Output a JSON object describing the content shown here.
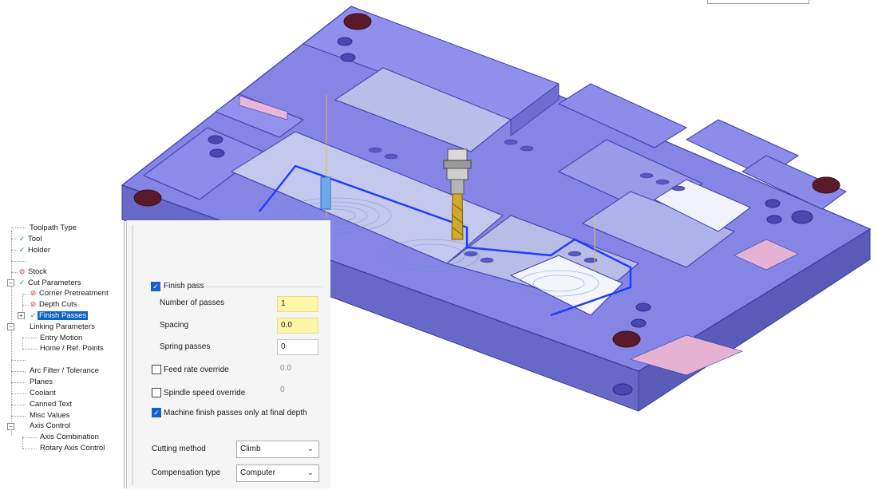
{
  "tree": {
    "items": [
      {
        "label": "Toolpath Type",
        "status": "none"
      },
      {
        "label": "Tool",
        "status": "ok"
      },
      {
        "label": "Holder",
        "status": "ok"
      },
      {
        "label": "Stock",
        "status": "bad"
      },
      {
        "label": "Cut Parameters",
        "status": "ok"
      },
      {
        "label": "Corner Pretreatment",
        "status": "bad"
      },
      {
        "label": "Depth Cuts",
        "status": "bad"
      },
      {
        "label": "Finish Passes",
        "status": "ok"
      },
      {
        "label": "Linking Parameters",
        "status": "none"
      },
      {
        "label": "Entry Motion",
        "status": "none"
      },
      {
        "label": "Home / Ref. Points",
        "status": "none"
      },
      {
        "label": "Arc Filter / Tolerance",
        "status": "none"
      },
      {
        "label": "Planes",
        "status": "none"
      },
      {
        "label": "Coolant",
        "status": "none"
      },
      {
        "label": "Canned Text",
        "status": "none"
      },
      {
        "label": "Misc Values",
        "status": "none"
      },
      {
        "label": "Axis Control",
        "status": "none"
      },
      {
        "label": "Axis Combination",
        "status": "none"
      },
      {
        "label": "Rotary Axis Control",
        "status": "none"
      }
    ],
    "selected": "Finish Passes"
  },
  "panel": {
    "finish_pass": {
      "label": "Finish pass",
      "checked": true
    },
    "number_of_passes": {
      "label": "Number of passes",
      "value": "1"
    },
    "spacing": {
      "label": "Spacing",
      "value": "0.0"
    },
    "spring_passes": {
      "label": "Spring passes",
      "value": "0"
    },
    "feed_rate_override": {
      "label": "Feed rate override",
      "checked": false,
      "value": "0.0"
    },
    "spindle_speed_override": {
      "label": "Spindle speed override",
      "checked": false,
      "value": "0"
    },
    "machine_finish_final_depth": {
      "label": "Machine finish passes only at final depth",
      "checked": true
    },
    "cutting_method": {
      "label": "Cutting method",
      "value": "Climb"
    },
    "compensation_type": {
      "label": "Compensation type",
      "value": "Computer"
    }
  },
  "icons": {
    "ok": "checkmark-icon",
    "bad": "prohibited-icon",
    "expand": "plus-expander-icon",
    "collapse": "minus-expander-icon",
    "dropdown": "chevron-down-icon",
    "check": "checkbox-check-icon"
  },
  "colors": {
    "model_fill": "#7e7ee0",
    "model_edge": "#3a3aa6",
    "toolpath": "#1e3cff",
    "selection": "#0a64c8",
    "ok": "#1b9a3c",
    "bad": "#d0302a",
    "highlight_field": "#fbf7a6"
  }
}
